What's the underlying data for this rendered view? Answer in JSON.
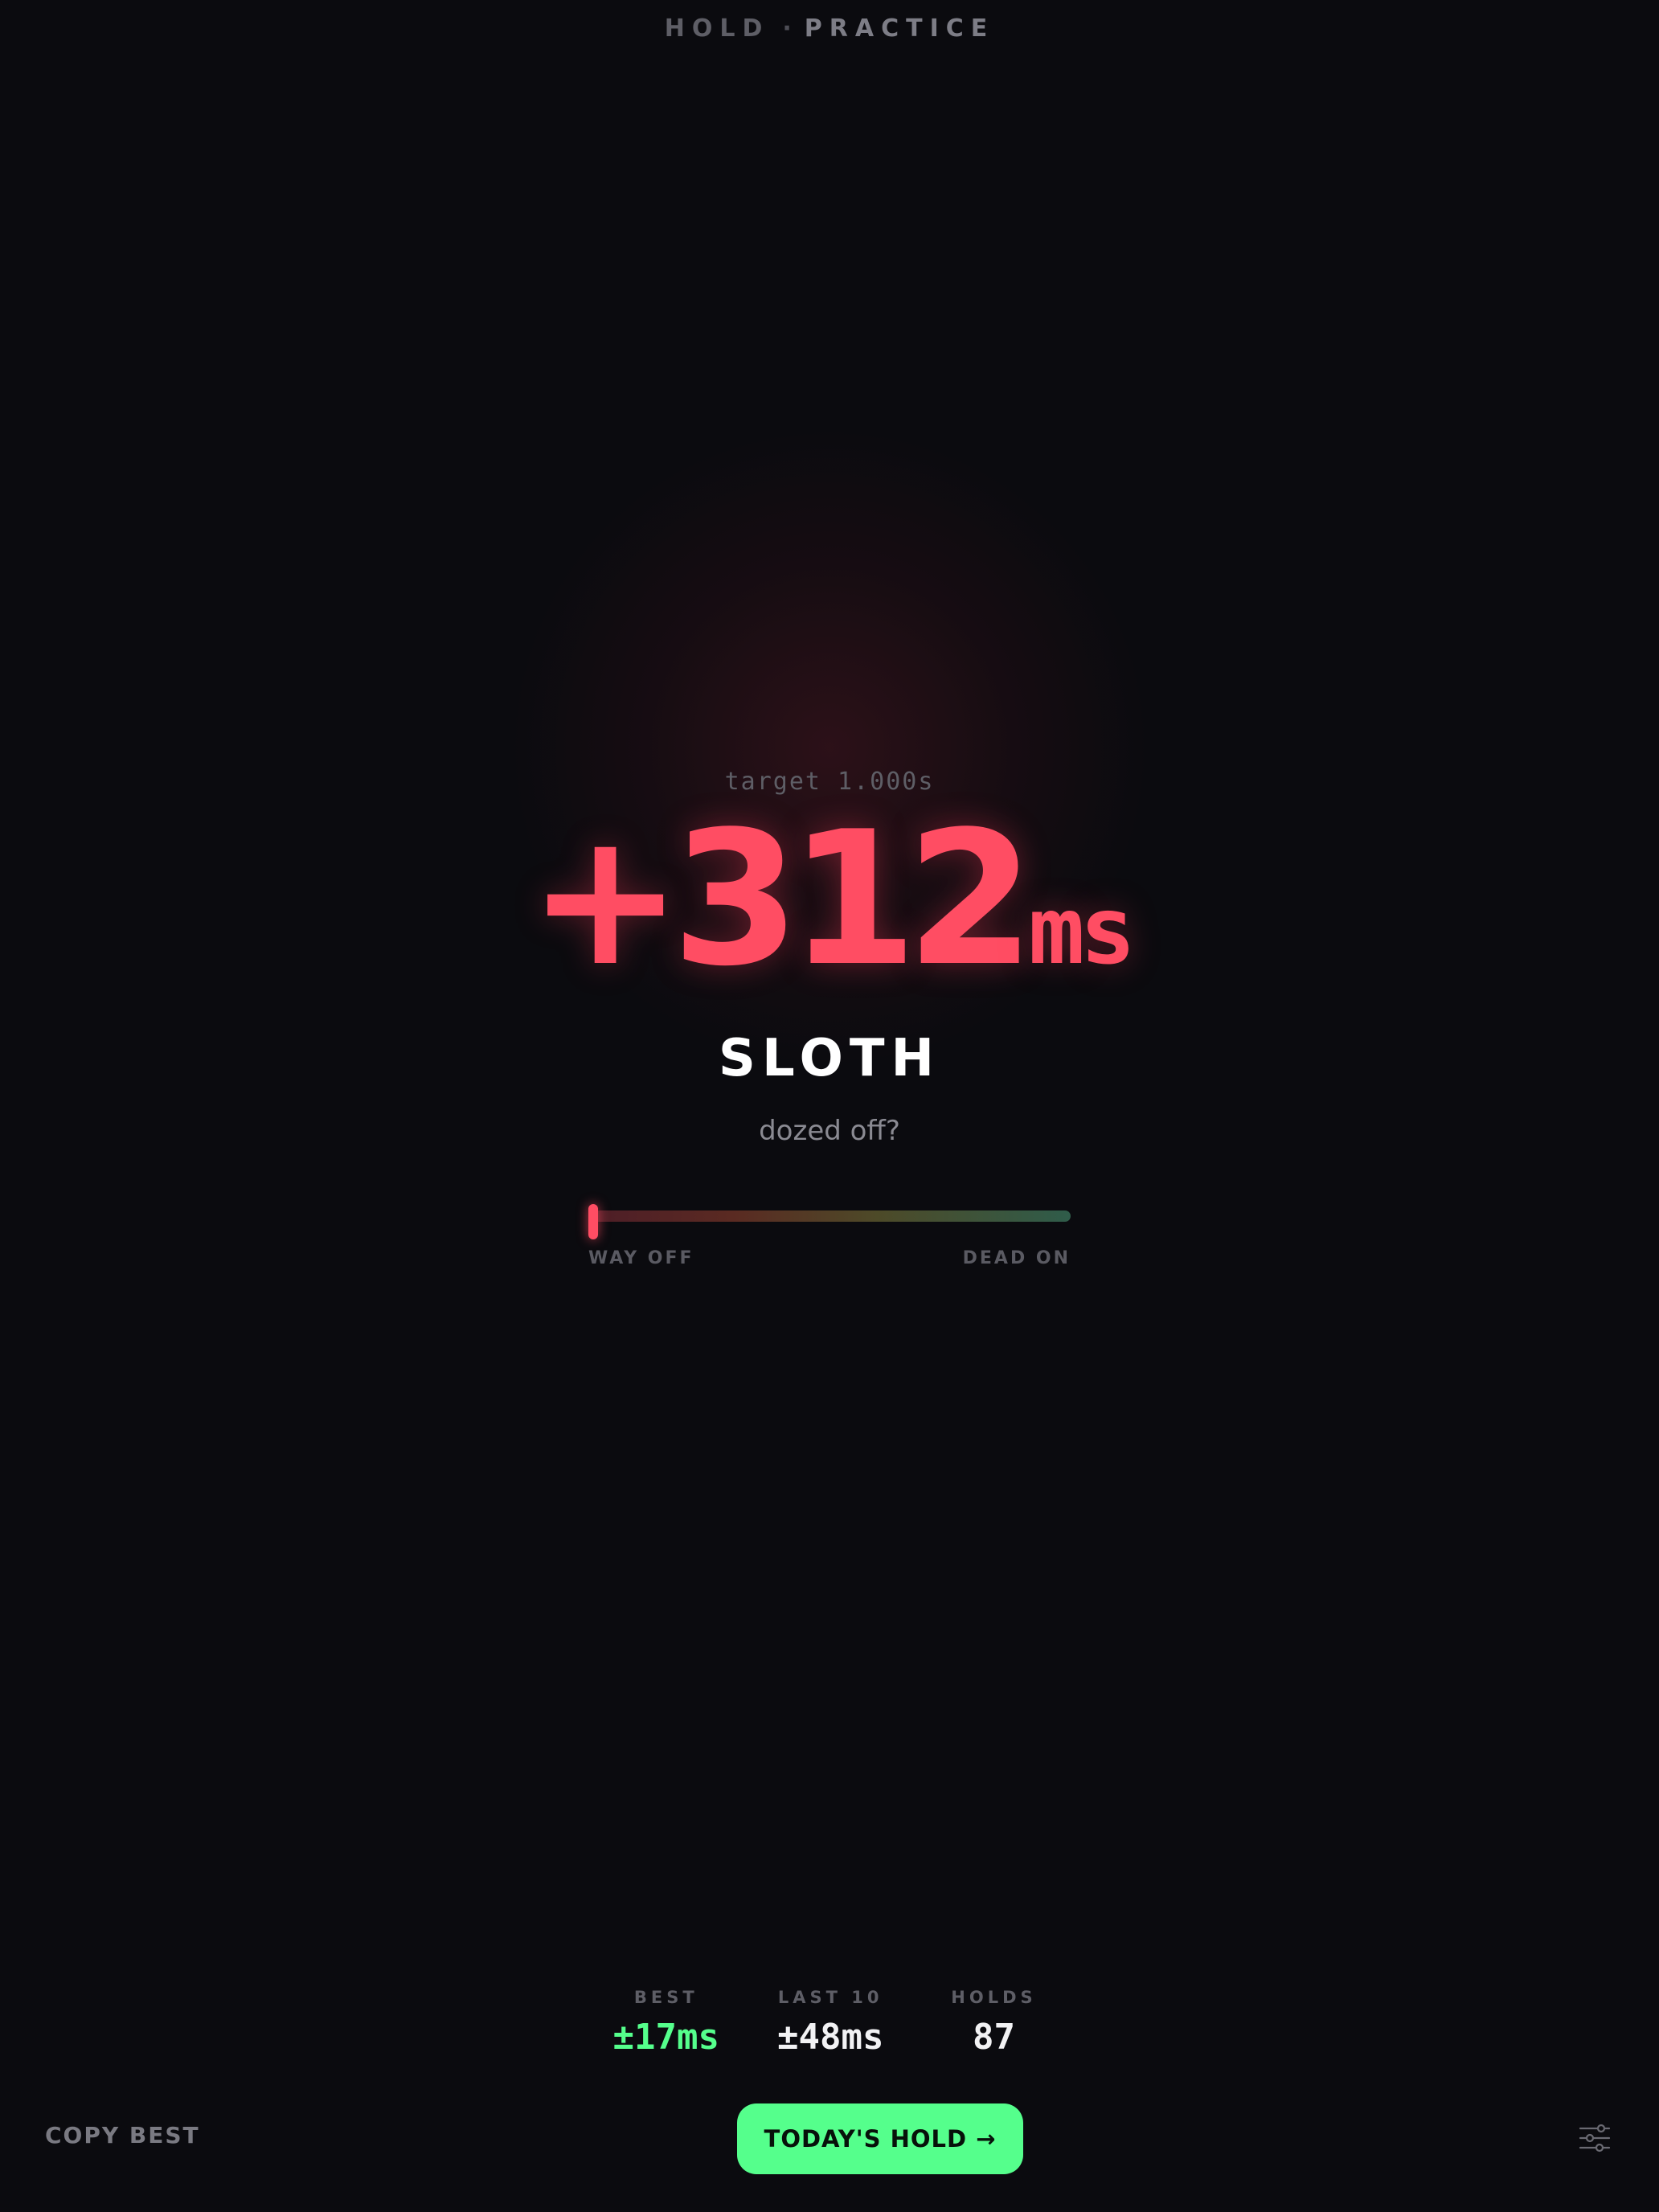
{
  "header": {
    "title": "HOLD",
    "separator": "·",
    "mode": "PRACTICE"
  },
  "result": {
    "target": "target 1.000s",
    "delta": "+312",
    "unit": "ms",
    "rank": "SLOTH",
    "quip": "dozed off?",
    "accuracy": 0.0
  },
  "meter": {
    "left_label": "WAY OFF",
    "right_label": "DEAD ON"
  },
  "stats": [
    {
      "label": "BEST",
      "value": "±17ms"
    },
    {
      "label": "LAST 10",
      "value": "±48ms"
    },
    {
      "label": "HOLDS",
      "value": "87"
    }
  ],
  "footer": {
    "copy_label": "COPY BEST",
    "today_label": "TODAY'S HOLD →",
    "settings_icon": "sliders-icon"
  },
  "colors": {
    "background": "#0b0b0f",
    "miss": "#ff4d63",
    "good": "#55ff8c"
  }
}
